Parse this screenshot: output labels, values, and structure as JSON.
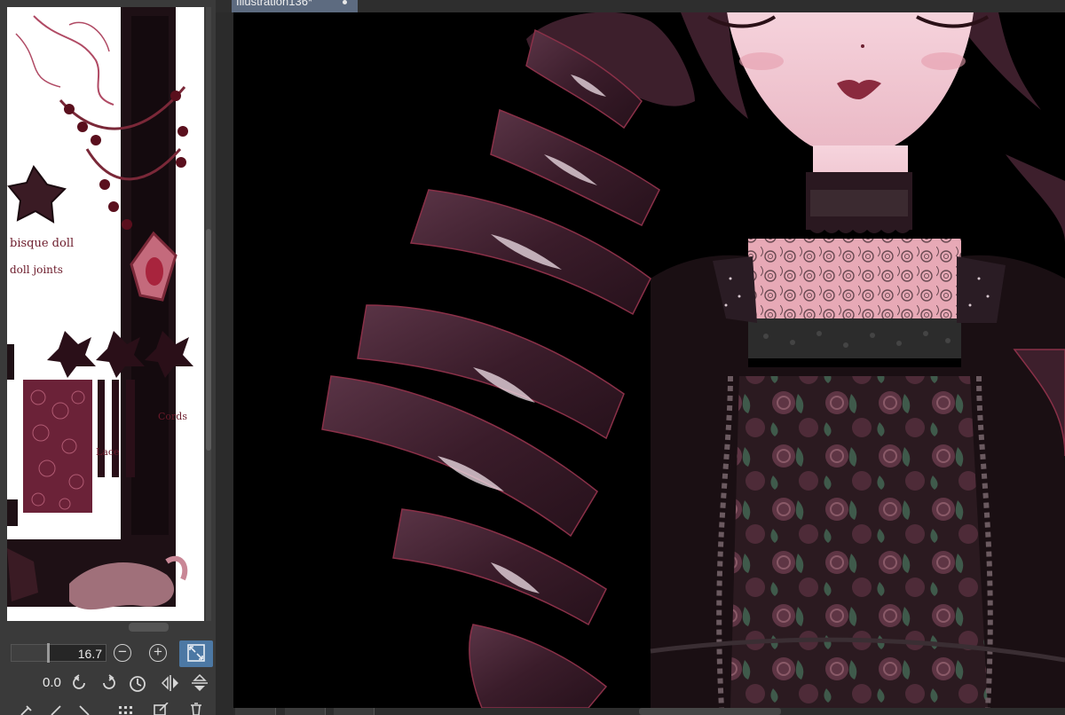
{
  "document_tab": {
    "title": "Illustration136*",
    "modified": true
  },
  "navigator": {
    "zoom_value": "16.7",
    "rotation_value": "0.0",
    "zoom_level_fraction": 0.38
  },
  "preview_sheet": {
    "handwritten_notes": [
      "bisque doll",
      "doll joints",
      "Lace",
      "Cords"
    ]
  },
  "icons": {
    "zoom_out": "minus-circle-icon",
    "zoom_in": "plus-circle-icon",
    "fit": "fit-to-window-icon",
    "rotate_left": "rotate-left-icon",
    "rotate_right": "rotate-right-icon",
    "reset_rotation": "reset-rotation-icon",
    "flip_horizontal": "flip-horizontal-icon",
    "flip_vertical": "flip-vertical-icon"
  },
  "colors": {
    "panel_bg": "#3a3a3a",
    "tab_active": "#5d6b80",
    "fit_button": "#4c78a4",
    "canvas_bg": "#000000",
    "hair": "#3d1f2c",
    "skin": "#f2c9d3",
    "lace_accent": "#b05a72"
  }
}
